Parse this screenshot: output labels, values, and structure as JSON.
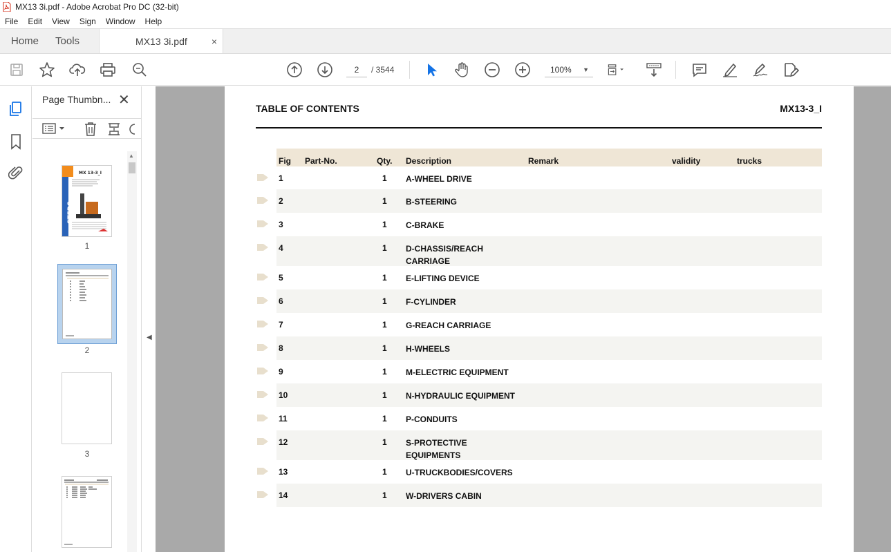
{
  "window": {
    "title": "MX13 3i.pdf - Adobe Acrobat Pro DC (32-bit)"
  },
  "menu": [
    "File",
    "Edit",
    "View",
    "Sign",
    "Window",
    "Help"
  ],
  "tabs": {
    "home": "Home",
    "tools": "Tools",
    "document": "MX13 3i.pdf",
    "close": "×"
  },
  "toolbar": {
    "current_page": "2",
    "total_pages": "/ 3544",
    "zoom": "100%"
  },
  "icons": {
    "save": "save-icon",
    "bookmark_star": "star-icon",
    "upload": "upload-icon",
    "print": "print-icon",
    "find": "search-zoom-icon",
    "prev_page": "arrow-up-circle-icon",
    "next_page": "arrow-down-circle-icon",
    "select": "cursor-arrow-icon",
    "hand": "hand-icon",
    "zoom_out": "minus-circle-icon",
    "zoom_in": "plus-circle-icon",
    "fit": "fit-page-icon",
    "scroll_mode": "scroll-mode-icon",
    "comment": "comment-icon",
    "highlight": "highlighter-icon",
    "sign": "sign-icon",
    "edit": "edit-pdf-icon"
  },
  "sidebar": {
    "panel_title": "Page Thumbn...",
    "close": "✕",
    "thumbnails": [
      {
        "label": "1",
        "selected": false
      },
      {
        "label": "2",
        "selected": true
      },
      {
        "label": "3",
        "selected": false
      },
      {
        "label": "",
        "selected": false
      }
    ]
  },
  "document": {
    "heading": "TABLE OF CONTENTS",
    "model": "MX13-3_I",
    "table": {
      "columns": [
        "Fig",
        "Part-No.",
        "Qty.",
        "Description",
        "Remark",
        "validity",
        "trucks"
      ],
      "rows": [
        {
          "fig": "1",
          "part": "",
          "qty": "1",
          "desc": "A-WHEEL DRIVE",
          "desc2": ""
        },
        {
          "fig": "2",
          "part": "",
          "qty": "1",
          "desc": "B-STEERING",
          "desc2": ""
        },
        {
          "fig": "3",
          "part": "",
          "qty": "1",
          "desc": "C-BRAKE",
          "desc2": ""
        },
        {
          "fig": "4",
          "part": "",
          "qty": "1",
          "desc": "D-CHASSIS/REACH",
          "desc2": "CARRIAGE"
        },
        {
          "fig": "5",
          "part": "",
          "qty": "1",
          "desc": "E-LIFTING DEVICE",
          "desc2": ""
        },
        {
          "fig": "6",
          "part": "",
          "qty": "1",
          "desc": "F-CYLINDER",
          "desc2": ""
        },
        {
          "fig": "7",
          "part": "",
          "qty": "1",
          "desc": "G-REACH CARRIAGE",
          "desc2": ""
        },
        {
          "fig": "8",
          "part": "",
          "qty": "1",
          "desc": "H-WHEELS",
          "desc2": ""
        },
        {
          "fig": "9",
          "part": "",
          "qty": "1",
          "desc": "M-ELECTRIC EQUIPMENT",
          "desc2": ""
        },
        {
          "fig": "10",
          "part": "",
          "qty": "1",
          "desc": "N-HYDRAULIC EQUIPMENT",
          "desc2": ""
        },
        {
          "fig": "11",
          "part": "",
          "qty": "1",
          "desc": "P-CONDUITS",
          "desc2": ""
        },
        {
          "fig": "12",
          "part": "",
          "qty": "1",
          "desc": "S-PROTECTIVE",
          "desc2": "EQUIPMENTS"
        },
        {
          "fig": "13",
          "part": "",
          "qty": "1",
          "desc": "U-TRUCKBODIES/COVERS",
          "desc2": ""
        },
        {
          "fig": "14",
          "part": "",
          "qty": "1",
          "desc": "W-DRIVERS CABIN",
          "desc2": ""
        }
      ]
    }
  },
  "colors": {
    "accent_blue": "#1473e6",
    "header_band": "#efe6d6",
    "row_alt": "#f4f4f1",
    "viewport_bg": "#a9a9a9"
  }
}
